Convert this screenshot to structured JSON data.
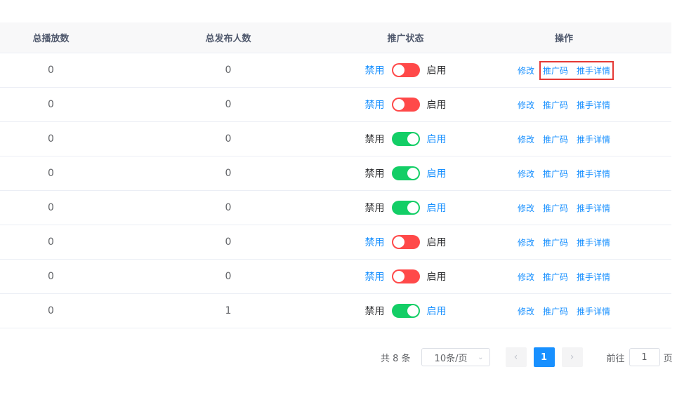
{
  "table": {
    "headers": {
      "plays": "总播放数",
      "publishers": "总发布人数",
      "status": "推广状态",
      "actions": "操作"
    },
    "status_labels": {
      "disable": "禁用",
      "enable": "启用"
    },
    "action_labels": {
      "edit": "修改",
      "promo_code": "推广码",
      "promoter_detail": "推手详情"
    },
    "rows": [
      {
        "plays": "0",
        "publishers": "0",
        "enabled": false
      },
      {
        "plays": "0",
        "publishers": "0",
        "enabled": false
      },
      {
        "plays": "0",
        "publishers": "0",
        "enabled": true
      },
      {
        "plays": "0",
        "publishers": "0",
        "enabled": true
      },
      {
        "plays": "0",
        "publishers": "0",
        "enabled": true
      },
      {
        "plays": "0",
        "publishers": "0",
        "enabled": false
      },
      {
        "plays": "0",
        "publishers": "0",
        "enabled": false
      },
      {
        "plays": "0",
        "publishers": "1",
        "enabled": true
      }
    ],
    "highlighted_row": 0
  },
  "pagination": {
    "total": "共 8 条",
    "page_size": "10条/页",
    "prev_icon": "chevron-left-icon",
    "next_icon": "chevron-right-icon",
    "current_page": "1",
    "jump_label": "前往",
    "jump_value": "1",
    "page_unit": "页"
  },
  "colors": {
    "link": "#1890ff",
    "switch_on": "#13ce66",
    "switch_off": "#ff4949",
    "highlight_box": "#e53935"
  }
}
